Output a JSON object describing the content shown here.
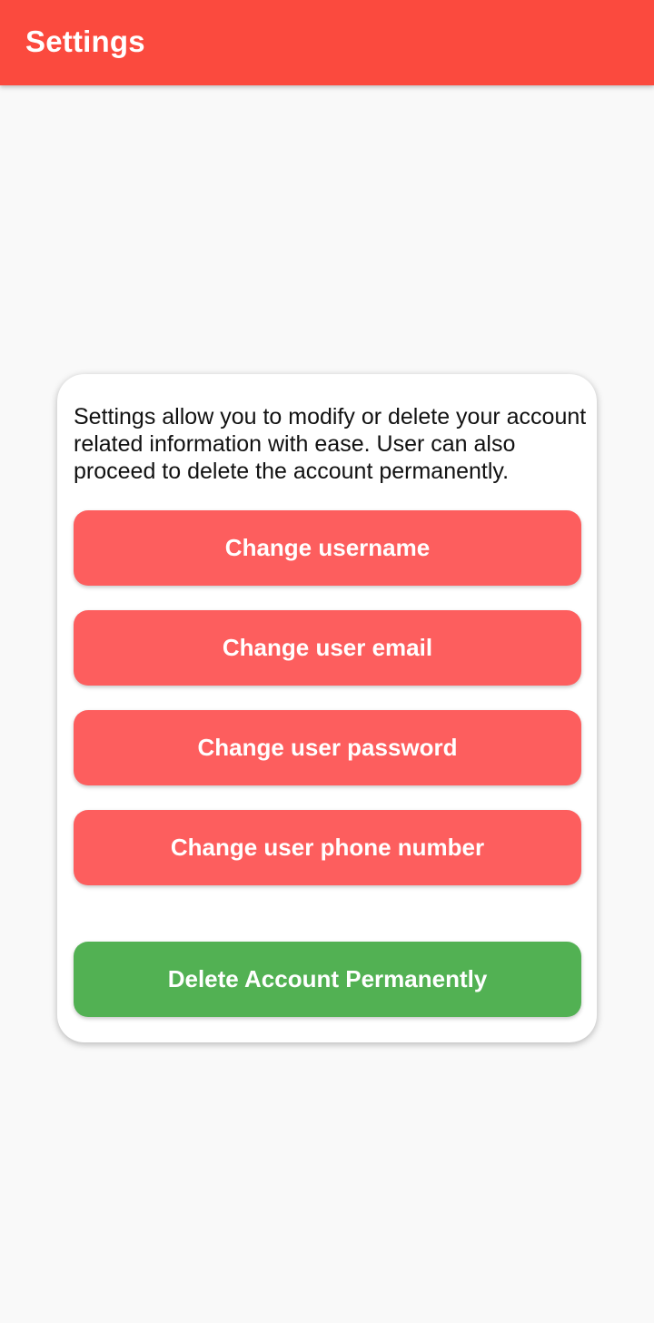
{
  "app_bar": {
    "title": "Settings",
    "color": "#fb4a3e"
  },
  "card": {
    "description": "Settings allow you to modify or delete your account related information with ease. User can also proceed to delete the account permanently.",
    "buttons": [
      {
        "label": "Change username",
        "color": "#fd5e5e"
      },
      {
        "label": "Change user email",
        "color": "#fd5e5e"
      },
      {
        "label": "Change user password",
        "color": "#fd5e5e"
      },
      {
        "label": "Change user phone number",
        "color": "#fd5e5e"
      }
    ],
    "delete_button": {
      "label": "Delete Account Permanently",
      "color": "#52b153"
    }
  }
}
